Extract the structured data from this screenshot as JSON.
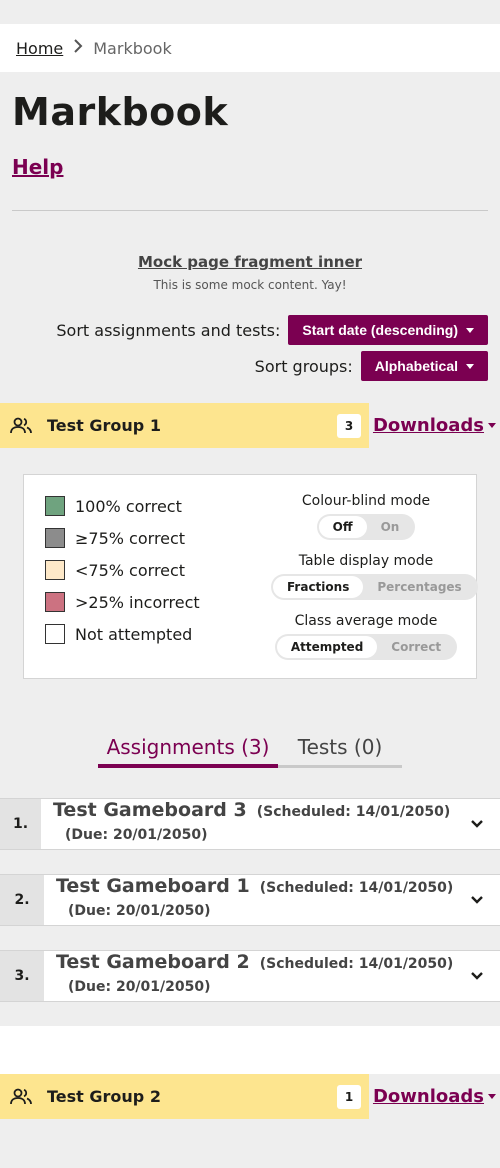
{
  "breadcrumb": {
    "home": "Home",
    "current": "Markbook"
  },
  "page": {
    "title": "Markbook",
    "help": "Help"
  },
  "mock": {
    "title": "Mock page fragment inner",
    "text": "This is some mock content. Yay!"
  },
  "sort": {
    "assignments_label": "Sort assignments and tests:",
    "assignments_value": "Start date (descending)",
    "groups_label": "Sort groups:",
    "groups_value": "Alphabetical"
  },
  "groups": [
    {
      "name": "Test Group 1",
      "count": "3",
      "downloads": "Downloads"
    },
    {
      "name": "Test Group 2",
      "count": "1",
      "downloads": "Downloads"
    }
  ],
  "legend": {
    "items": [
      {
        "label": "100% correct",
        "color": "#6fa37f"
      },
      {
        "label": "≥75% correct",
        "color": "#8c8c8c"
      },
      {
        "label": "<75% correct",
        "color": "#fde8c8"
      },
      {
        "label": ">25% incorrect",
        "color": "#cc7281"
      },
      {
        "label": "Not attempted",
        "color": "#ffffff"
      }
    ],
    "colour_blind": {
      "label": "Colour-blind mode",
      "off": "Off",
      "on": "On",
      "selected": "Off"
    },
    "table_display": {
      "label": "Table display mode",
      "a": "Fractions",
      "b": "Percentages",
      "selected": "Fractions"
    },
    "class_average": {
      "label": "Class average mode",
      "a": "Attempted",
      "b": "Correct",
      "selected": "Attempted"
    }
  },
  "tabs": {
    "assignments": "Assignments (3)",
    "tests": "Tests (0)"
  },
  "assignments": [
    {
      "num": "1.",
      "title": "Test Gameboard 3",
      "scheduled": "(Scheduled: 14/01/2050)",
      "due": "(Due: 20/01/2050)"
    },
    {
      "num": "2.",
      "title": "Test Gameboard 1",
      "scheduled": "(Scheduled: 14/01/2050)",
      "due": "(Due: 20/01/2050)"
    },
    {
      "num": "3.",
      "title": "Test Gameboard 2",
      "scheduled": "(Scheduled: 14/01/2050)",
      "due": "(Due: 20/01/2050)"
    }
  ],
  "colors": {
    "accent": "#7b0051",
    "group_bar": "#fde58f"
  }
}
